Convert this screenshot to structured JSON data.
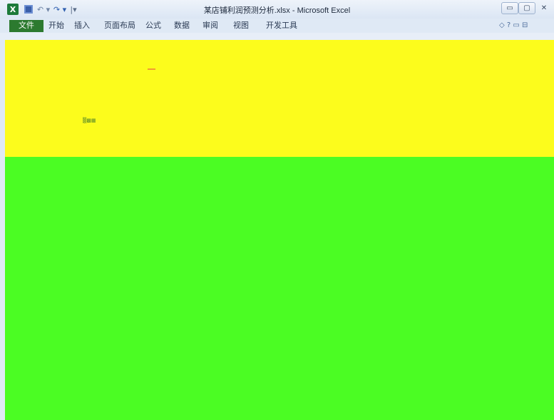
{
  "window": {
    "title": "某店铺利润预测分析.xlsx - Microsoft Excel"
  },
  "qat": {
    "logo_glyph": "X",
    "undo_glyph": "↶ ▾",
    "redo_glyph": "↷ ▾",
    "customize_glyph": "|▾"
  },
  "window_controls": {
    "minimize": "▭",
    "maximize": "▢",
    "close": "✕"
  },
  "ribbon_tabs": [
    {
      "label": "文件"
    },
    {
      "label": "开始"
    },
    {
      "label": "插入"
    },
    {
      "label": "页面布局"
    },
    {
      "label": "公式"
    },
    {
      "label": "数据"
    },
    {
      "label": "审阅"
    },
    {
      "label": "视图"
    },
    {
      "label": "开发工具"
    }
  ],
  "ribbon_misc": {
    "help": "◇ ? ▭ ⊟"
  },
  "cell_marker": "▒▩▦"
}
